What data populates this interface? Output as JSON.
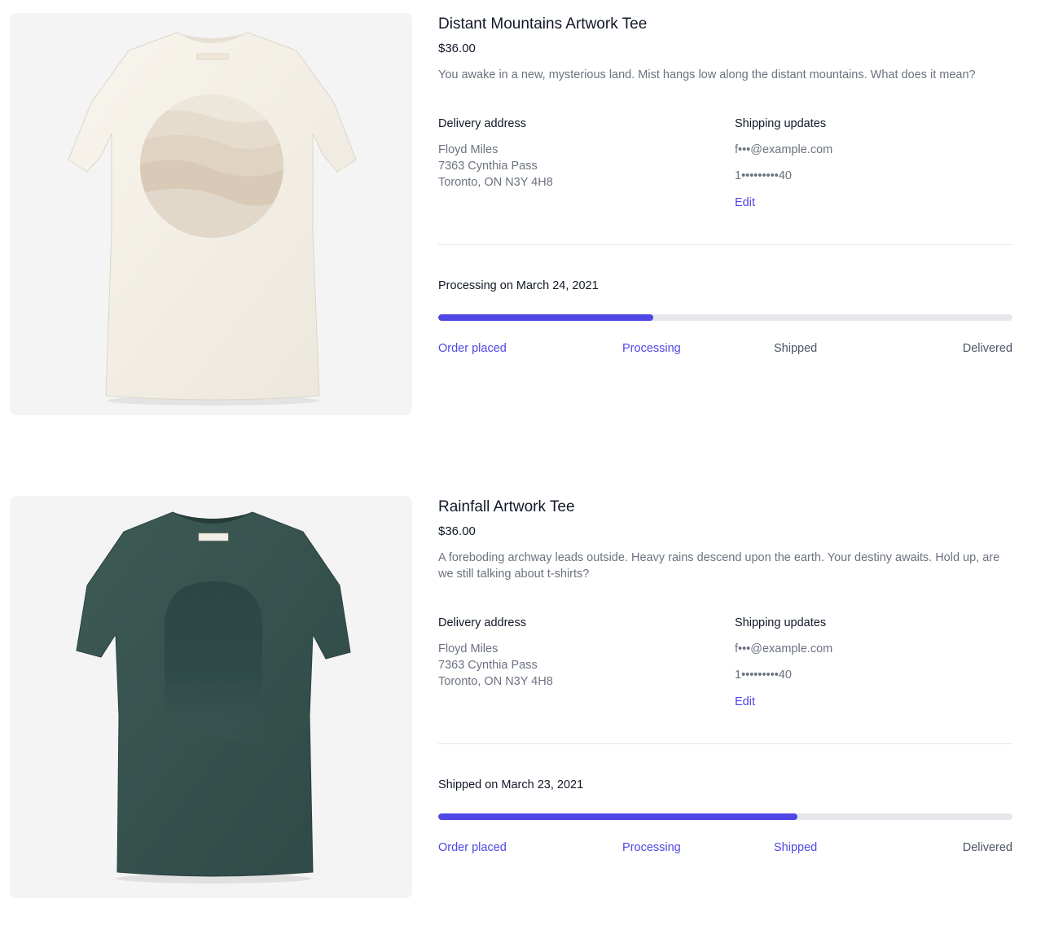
{
  "orders": [
    {
      "product": {
        "name": "Distant Mountains Artwork Tee",
        "price": "$36.00",
        "description": "You awake in a new, mysterious land. Mist hangs low along the distant mountains. What does it mean?",
        "image": "cream-tshirt-with-mountain-circle-artwork"
      },
      "delivery": {
        "heading": "Delivery address",
        "name": "Floyd Miles",
        "street": "7363 Cynthia Pass",
        "city": "Toronto, ON N3Y 4H8"
      },
      "shipping_updates": {
        "heading": "Shipping updates",
        "email": "f•••@example.com",
        "phone": "1•••••••••40",
        "edit_label": "Edit"
      },
      "status": {
        "text": "Processing on March 24, 2021",
        "progress": 0.375,
        "steps": [
          "Order placed",
          "Processing",
          "Shipped",
          "Delivered"
        ],
        "completed_steps": 2
      }
    },
    {
      "product": {
        "name": "Rainfall Artwork Tee",
        "price": "$36.00",
        "description": "A foreboding archway leads outside. Heavy rains descend upon the earth. Your destiny awaits. Hold up, are we still talking about t-shirts?",
        "image": "dark-green-tshirt-with-archway-artwork"
      },
      "delivery": {
        "heading": "Delivery address",
        "name": "Floyd Miles",
        "street": "7363 Cynthia Pass",
        "city": "Toronto, ON N3Y 4H8"
      },
      "shipping_updates": {
        "heading": "Shipping updates",
        "email": "f•••@example.com",
        "phone": "1•••••••••40",
        "edit_label": "Edit"
      },
      "status": {
        "text": "Shipped on March 23, 2021",
        "progress": 0.625,
        "steps": [
          "Order placed",
          "Processing",
          "Shipped",
          "Delivered"
        ],
        "completed_steps": 3
      }
    }
  ],
  "colors": {
    "accent": "#4f46e5",
    "track": "#e5e7eb",
    "muted_text": "#6b7280",
    "heading_text": "#111827"
  }
}
